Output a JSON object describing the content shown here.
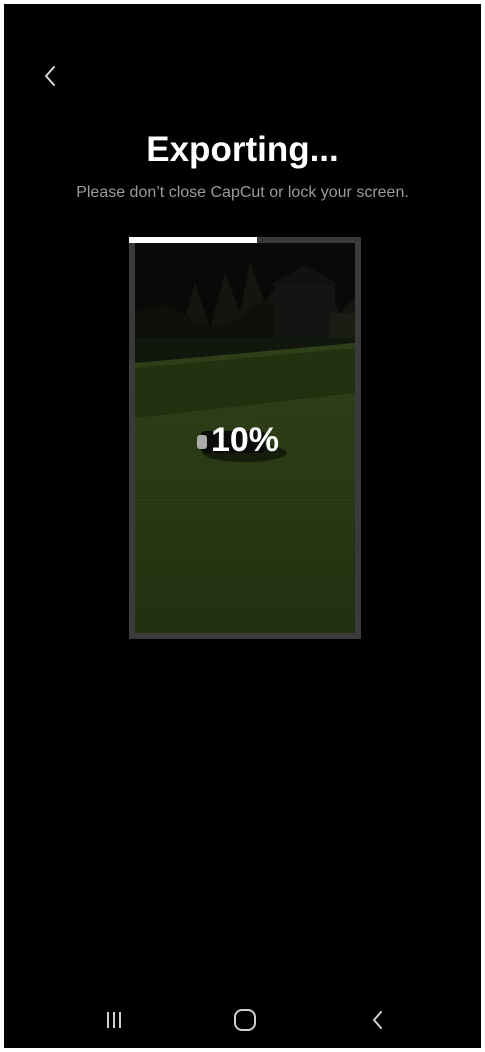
{
  "header": {
    "title": "Exporting...",
    "subtitle": "Please don’t close CapCut or lock your screen."
  },
  "export": {
    "progress_label": "10%",
    "progress_fraction": 0.55
  },
  "icons": {
    "back": "chevron-left-icon",
    "nav_recents": "recents-icon",
    "nav_home": "home-icon",
    "nav_back": "back-icon"
  },
  "colors": {
    "background": "#000000",
    "title": "#ffffff",
    "subtitle": "#9b9b9b",
    "progress_fill": "#ffffff",
    "frame": "#3a3a3a"
  }
}
